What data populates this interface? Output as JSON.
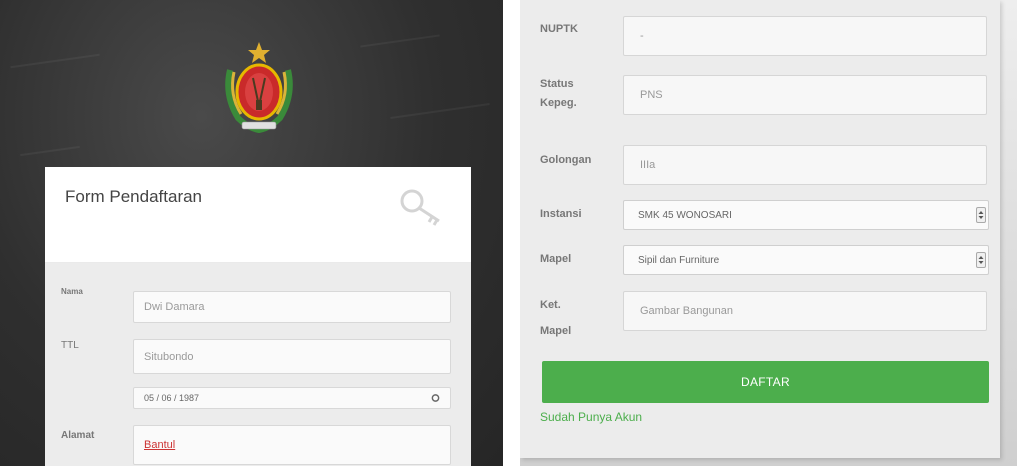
{
  "left_form": {
    "title": "Form Pendaftaran",
    "fields": {
      "nama_label": "Nama",
      "nama_value": "Dwi Damara",
      "ttl_label": "TTL",
      "ttl_place": "Situbondo",
      "ttl_date": "05 / 06 / 1987",
      "alamat_label": "Alamat",
      "alamat_value": "Bantul"
    }
  },
  "right_form": {
    "nuptk_label": "NUPTK",
    "nuptk_value": "-",
    "status_label_1": "Status",
    "status_label_2": "Kepeg.",
    "status_value": "PNS",
    "golongan_label": "Golongan",
    "golongan_value": "IIIa",
    "instansi_label": "Instansi",
    "instansi_value": "SMK 45 WONOSARI",
    "mapel_label": "Mapel",
    "mapel_value": "Sipil dan Furniture",
    "ketmapel_label_1": "Ket.",
    "ketmapel_label_2": "Mapel",
    "ketmapel_value": "Gambar Bangunan",
    "submit_label": "DAFTAR",
    "login_link": "Sudah Punya Akun"
  },
  "icons": {
    "emblem": "government-emblem-icon",
    "key": "key-icon",
    "calendar": "calendar-icon",
    "select": "select-arrow-icon"
  },
  "colors": {
    "accent_green": "#4cae4c",
    "background_dark": "#2f2f2f"
  }
}
